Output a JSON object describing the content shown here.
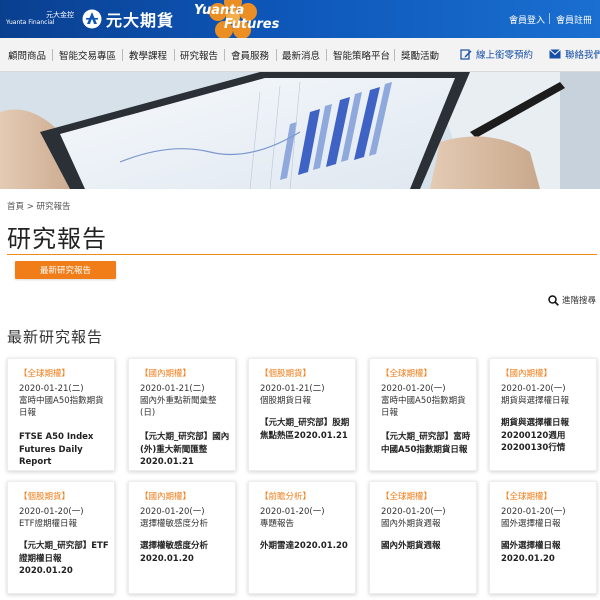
{
  "header": {
    "logo_sub_line1": "元大金控",
    "logo_sub_line2": "Yuanta Financial",
    "logo_cn": "元大期貨",
    "brand_en_1": "Yuanta",
    "brand_en_2": "Futures",
    "member_login": "會員登入",
    "member_register": "會員註冊"
  },
  "nav": {
    "items": [
      "顧問商品",
      "智能交易專區",
      "教學課程",
      "研究報告",
      "會員服務",
      "最新消息",
      "智能策略平台",
      "獎勵活動"
    ],
    "online_account": "線上銜零預約",
    "contact": "聯絡我們"
  },
  "breadcrumb": "首頁 > 研究報告",
  "page_title": "研究報告",
  "tab_label": "最新研究報告",
  "advanced_search": "進階搜尋",
  "section_title": "最新研究報告",
  "cards": [
    {
      "tag": "【全球期權】",
      "date": "2020-01-21(二)",
      "subtitle": "富時中國A50指數期貨日報",
      "body": "FTSE A50 Index Futures Daily Report"
    },
    {
      "tag": "【國內期權】",
      "date": "2020-01-21(二)",
      "subtitle": "國內外重點新聞彙整(日)",
      "body": "【元大期_研究部】國內(外)重大新聞匯整2020.01.21"
    },
    {
      "tag": "【個股期貨】",
      "date": "2020-01-21(二)",
      "subtitle": "個股期貨日報",
      "body": "【元大期_研究部】股期焦點熱區2020.01.21"
    },
    {
      "tag": "【全球期權】",
      "date": "2020-01-20(一)",
      "subtitle": "富時中國A50指數期貨日報",
      "body": "【元大期_研究部】富時中國A50指數期貨日報"
    },
    {
      "tag": "【國內期權】",
      "date": "2020-01-20(一)",
      "subtitle": "期貨與選擇權日報",
      "body": "期貨與選擇權日報20200120週用20200130行情"
    },
    {
      "tag": "【個股期貨】",
      "date": "2020-01-20(一)",
      "subtitle": "ETF證期權日報",
      "body": "【元大期_研究部】ETF證期權日報2020.01.20"
    },
    {
      "tag": "【國內期權】",
      "date": "2020-01-20(一)",
      "subtitle": "選擇權敏感度分析",
      "body": "選擇權敏感度分析2020.01.20"
    },
    {
      "tag": "【前瞻分析】",
      "date": "2020-01-20(一)",
      "subtitle": "專題報告",
      "body": "外期雷達2020.01.20"
    },
    {
      "tag": "【全球期權】",
      "date": "2020-01-20(一)",
      "subtitle": "國內外期貨週報",
      "body": "國內外期貨週報"
    },
    {
      "tag": "【全球期權】",
      "date": "2020-01-20(一)",
      "subtitle": "國外選擇權日報",
      "body": "國外選擇權日報2020.01.20"
    }
  ],
  "colors": {
    "header_blue": "#0d56b8",
    "accent_orange": "#f07d18",
    "link_blue": "#1750a6"
  }
}
